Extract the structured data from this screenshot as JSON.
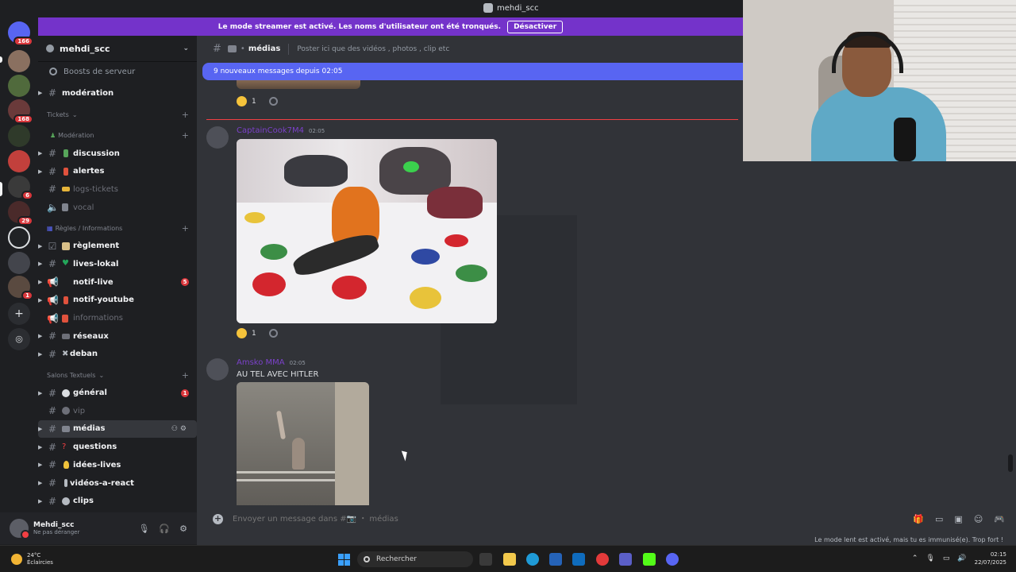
{
  "window": {
    "title": "mehdi_scc"
  },
  "banner": {
    "message": "Le mode streamer est activé. Les noms d'utilisateur ont été tronqués.",
    "button_label": "Désactiver"
  },
  "servers": [
    {
      "name": "server-home",
      "badge": "166"
    },
    {
      "name": "server-1",
      "badge": ""
    },
    {
      "name": "server-2",
      "badge": ""
    },
    {
      "name": "server-3",
      "badge": "168"
    },
    {
      "name": "server-4",
      "badge": ""
    },
    {
      "name": "server-5",
      "badge": ""
    },
    {
      "name": "server-6",
      "badge": "6"
    },
    {
      "name": "server-7",
      "badge": "29"
    },
    {
      "name": "server-8",
      "badge": ""
    },
    {
      "name": "server-9",
      "badge": ""
    },
    {
      "name": "server-10",
      "badge": ""
    },
    {
      "name": "server-11",
      "badge": "1"
    }
  ],
  "sidebar": {
    "server_name": "mehdi_scc",
    "boost_label": "Boosts de serveur",
    "channels": {
      "moderation": "modération",
      "cat_tickets": "Tickets",
      "cat_moderation": "Modération",
      "discussion": "discussion",
      "alertes": "alertes",
      "logs_tickets": "logs-tickets",
      "vocal": "vocal",
      "cat_regles": "Règles / Informations",
      "reglement": "règlement",
      "lives_lokal": "lives-lokal",
      "notif_live": "notif-live",
      "notif_live_badge": "5",
      "notif_youtube": "notif-youtube",
      "informations": "informations",
      "reseaux": "réseaux",
      "deban": "deban",
      "cat_salons": "Salons Textuels",
      "general": "général",
      "general_badge": "1",
      "vip": "vip",
      "medias": "médias",
      "questions": "questions",
      "idees_lives": "idées-lives",
      "videos_a_react": "vidéos-a-react",
      "clips": "clips"
    }
  },
  "user": {
    "name": "Mehdi_scc",
    "status": "Ne pas déranger"
  },
  "channel_header": {
    "name": "médias",
    "topic": "Poster ici que des vidéos , photos , clip etc"
  },
  "new_messages_bar": "9 nouveaux messages depuis 02:05",
  "messages": [
    {
      "reaction_count": "1"
    },
    {
      "author": "CaptainCook7M4",
      "time": "02:05",
      "reaction_count": "1"
    },
    {
      "author": "Amsko MMA",
      "time": "02:05",
      "text": "AU TEL AVEC HITLER"
    }
  ],
  "composer": {
    "placeholder": "Envoyer un message dans #📷 ・ médias"
  },
  "slowmode": "Le mode lent est activé, mais tu es immunisé(e). Trop fort !",
  "taskbar": {
    "temp": "24°C",
    "weather": "Éclaircies",
    "search": "Rechercher",
    "time": "02:15",
    "date": "22/07/2025"
  },
  "colors": {
    "banner": "#7433ca",
    "blurple": "#5865f2",
    "new_line": "#f23f43",
    "author": "#7b41c9"
  }
}
